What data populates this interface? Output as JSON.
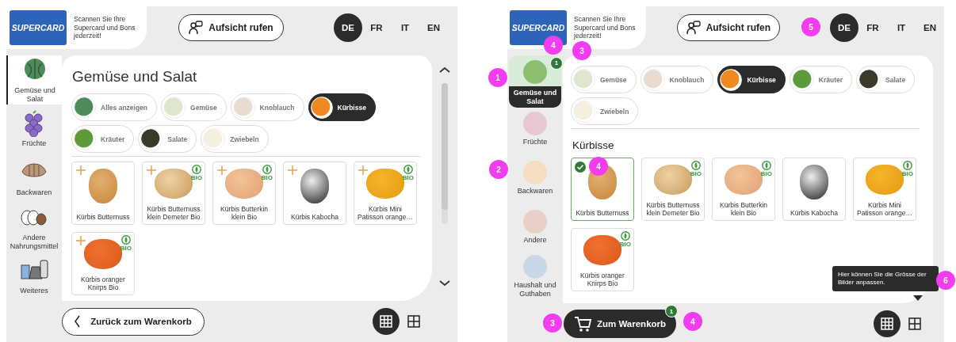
{
  "screens": [
    {
      "kind": "classic",
      "header": {
        "logo": "SUPERCARD",
        "scan_text": "Scannen Sie Ihre Supercard und Bons jederzeit!",
        "call_button": "Aufsicht rufen",
        "languages": [
          {
            "label": "DE",
            "selected": true
          },
          {
            "label": "FR",
            "selected": false
          },
          {
            "label": "IT",
            "selected": false
          },
          {
            "label": "EN",
            "selected": false
          }
        ]
      },
      "sidebar": [
        {
          "label": "Gemüse und Salat",
          "selected": true
        },
        {
          "label": "Früchte",
          "selected": false
        },
        {
          "label": "Backwaren",
          "selected": false
        },
        {
          "label": "Andere Nahrungsmittel",
          "selected": false
        },
        {
          "label": "Weiteres",
          "selected": false
        }
      ],
      "title": "Gemüse und Salat",
      "filters": [
        {
          "label": "Alles anzeigen",
          "selected": false
        },
        {
          "label": "Gemüse",
          "selected": false
        },
        {
          "label": "Knoblauch",
          "selected": false
        },
        {
          "label": "Kürbisse",
          "selected": true
        },
        {
          "label": "Kräuter",
          "selected": false
        },
        {
          "label": "Salate",
          "selected": false
        },
        {
          "label": "Zwiebeln",
          "selected": false
        }
      ],
      "products": [
        {
          "name": "Kürbis Butternuss",
          "kind": "add",
          "selected": false
        },
        {
          "name": "Kürbis Butternuss klein Demeter Bio",
          "kind": "add",
          "selected": false,
          "badge": "BIO"
        },
        {
          "name": "Kürbis Butterkin klein Bio",
          "kind": "add",
          "selected": false,
          "badge": "BIO"
        },
        {
          "name": "Kürbis Kabocha",
          "kind": "add",
          "selected": false
        },
        {
          "name": "Kürbis Mini Patisson orange…",
          "kind": "add",
          "selected": false,
          "badge": "BIO"
        },
        {
          "name": "Kürbis oranger Knirps Bio",
          "kind": "add",
          "selected": false,
          "badge": "BIO"
        }
      ],
      "back_button": "Zurück zum Warenkorb",
      "view_sizes": [
        {
          "selected": true
        },
        {
          "selected": false
        }
      ]
    },
    {
      "kind": "tiles",
      "header": {
        "logo": "SUPERCARD",
        "scan_text": "Scannen Sie Ihre Supercard und Bons jederzeit!",
        "call_button": "Aufsicht rufen",
        "languages": [
          {
            "label": "DE",
            "selected": true
          },
          {
            "label": "FR",
            "selected": false
          },
          {
            "label": "IT",
            "selected": false
          },
          {
            "label": "EN",
            "selected": false
          }
        ]
      },
      "sidebar": [
        {
          "label": "Gemüse und Salat",
          "selected": true,
          "count": "1"
        },
        {
          "label": "Früchte",
          "selected": false
        },
        {
          "label": "Backwaren",
          "selected": false
        },
        {
          "label": "Andere",
          "selected": false
        },
        {
          "label": "Haushalt und Guthaben",
          "selected": false
        }
      ],
      "filters": [
        {
          "label": "Gemüse",
          "selected": false
        },
        {
          "label": "Knoblauch",
          "selected": false
        },
        {
          "label": "Kürbisse",
          "selected": true
        },
        {
          "label": "Kräuter",
          "selected": false
        },
        {
          "label": "Salate",
          "selected": false
        },
        {
          "label": "Zwiebeln",
          "selected": false
        }
      ],
      "heading": "Kürbisse",
      "products": [
        {
          "name": "Kürbis Butternuss",
          "kind": "plain",
          "selected": true
        },
        {
          "name": "Kürbis Butternuss klein Demeter Bio",
          "kind": "plain",
          "selected": false,
          "badge": "BIO"
        },
        {
          "name": "Kürbis Butterkin klein Bio",
          "kind": "plain",
          "selected": false,
          "badge": "BIO"
        },
        {
          "name": "Kürbis Kabocha",
          "kind": "plain",
          "selected": false
        },
        {
          "name": "Kürbis Mini Patisson orange…",
          "kind": "plain",
          "selected": false,
          "badge": "BIO"
        },
        {
          "name": "Kürbis oranger Knirps Bio",
          "kind": "plain",
          "selected": false,
          "badge": "BIO"
        }
      ],
      "cart_button": {
        "label": "Zum Warenkorb",
        "count": "1"
      },
      "view_sizes": [
        {
          "selected": true
        },
        {
          "selected": false
        }
      ],
      "tooltip": "Hier können Sie die Grösse der Bilder anpassen.",
      "annotations": [
        "1",
        "4",
        "3",
        "5",
        "2",
        "4",
        "3",
        "4",
        "6"
      ]
    }
  ]
}
